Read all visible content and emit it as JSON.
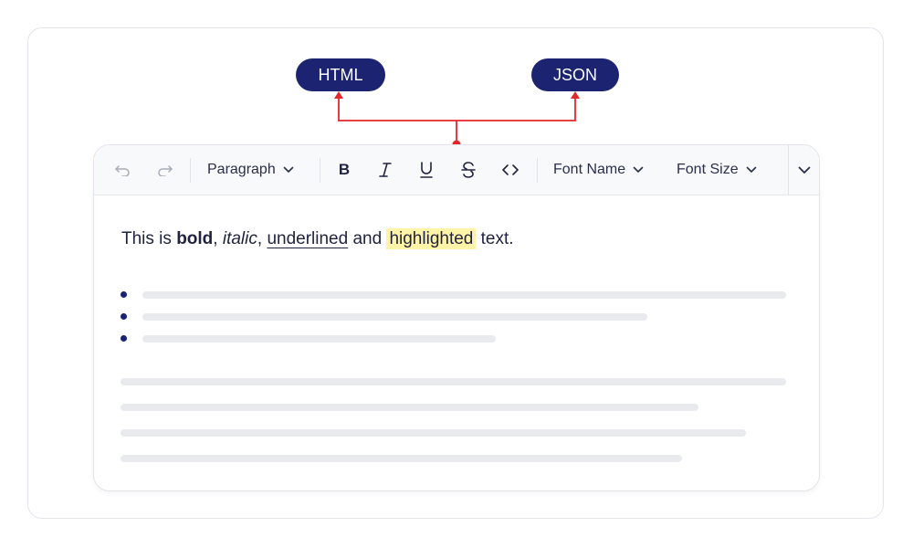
{
  "badges": {
    "html": "HTML",
    "json": "JSON"
  },
  "colors": {
    "accent": "#1c2370",
    "connector": "#e5262b",
    "highlight": "#fff3a8",
    "placeholder": "#e9eaed"
  },
  "toolbar": {
    "undo_icon": "undo-icon",
    "redo_icon": "redo-icon",
    "block_format": "Paragraph",
    "bold_icon": "bold-icon",
    "italic_icon": "italic-icon",
    "underline_icon": "underline-icon",
    "strikethrough_icon": "strikethrough-icon",
    "code_icon": "code-icon",
    "font_name": "Font Name",
    "font_size": "Font Size",
    "more_icon": "chevron-down-icon"
  },
  "content": {
    "sentence": {
      "prefix": "This is ",
      "bold": "bold",
      "sep1": ", ",
      "italic": "italic",
      "sep2": ", ",
      "underlined": "underlined",
      "sep3": " and ",
      "highlighted": "highlighted",
      "suffix": " text."
    }
  }
}
